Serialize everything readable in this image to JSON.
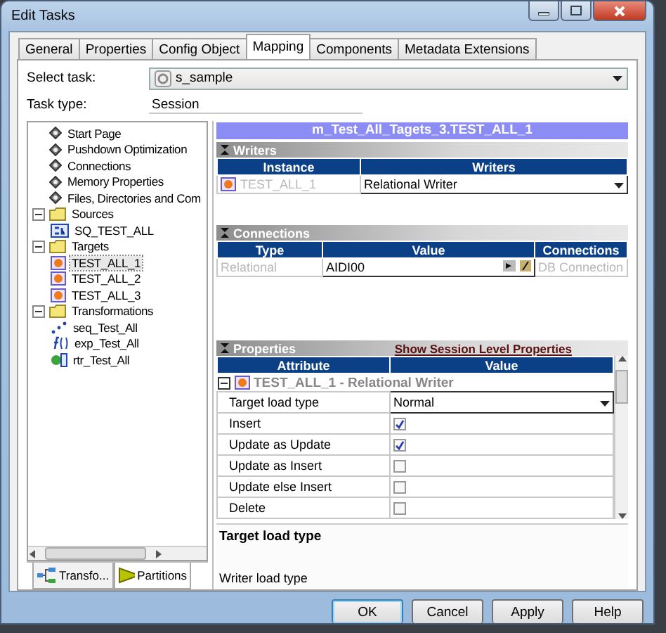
{
  "window": {
    "title": "Edit Tasks"
  },
  "tabs": [
    {
      "label": "General",
      "selected": false
    },
    {
      "label": "Properties",
      "selected": false
    },
    {
      "label": "Config Object",
      "selected": false
    },
    {
      "label": "Mapping",
      "selected": true
    },
    {
      "label": "Components",
      "selected": false
    },
    {
      "label": "Metadata Extensions",
      "selected": false
    }
  ],
  "select_task": {
    "label": "Select task:",
    "value": "s_sample"
  },
  "task_type": {
    "label": "Task type:",
    "value": "Session"
  },
  "tree": [
    {
      "label": "Start Page",
      "kind": "page",
      "selected": false
    },
    {
      "label": "Pushdown Optimization",
      "kind": "page",
      "selected": false
    },
    {
      "label": "Connections",
      "kind": "page",
      "selected": false
    },
    {
      "label": "Memory Properties",
      "kind": "page",
      "selected": false
    },
    {
      "label": "Files, Directories and Com",
      "kind": "page",
      "selected": false
    },
    {
      "label": "Sources",
      "kind": "folder",
      "selected": false,
      "expanded": true,
      "children": [
        {
          "label": "SQ_TEST_ALL",
          "kind": "source",
          "selected": false
        }
      ]
    },
    {
      "label": "Targets",
      "kind": "folder",
      "selected": false,
      "expanded": true,
      "children": [
        {
          "label": "TEST_ALL_1",
          "kind": "target",
          "selected": true
        },
        {
          "label": "TEST_ALL_2",
          "kind": "target",
          "selected": false
        },
        {
          "label": "TEST_ALL_3",
          "kind": "target",
          "selected": false
        }
      ]
    },
    {
      "label": "Transformations",
      "kind": "folder",
      "selected": false,
      "expanded": true,
      "children": [
        {
          "label": "seq_Test_All",
          "kind": "sequence",
          "selected": false
        },
        {
          "label": "exp_Test_All",
          "kind": "expression",
          "selected": false
        },
        {
          "label": "rtr_Test_All",
          "kind": "router",
          "selected": false
        }
      ]
    }
  ],
  "bottom_tabs": [
    {
      "label": "Transfo...",
      "kind": "transformations",
      "selected": false
    },
    {
      "label": "Partitions",
      "kind": "partitions",
      "selected": true
    }
  ],
  "mapping_title": "m_Test_All_Tagets_3.TEST_ALL_1",
  "writers": {
    "title": "Writers",
    "columns": [
      "Instance",
      "Writers"
    ],
    "rows": [
      {
        "instance": "TEST_ALL_1",
        "writer": "Relational Writer"
      }
    ]
  },
  "connections": {
    "title": "Connections",
    "columns": [
      "Type",
      "Value",
      "Connections"
    ],
    "rows": [
      {
        "type": "Relational",
        "value": "AIDI00",
        "connection": "DB Connection"
      }
    ]
  },
  "properties": {
    "title": "Properties",
    "link": "Show Session Level Properties",
    "columns": [
      "Attribute",
      "Value"
    ],
    "group": "TEST_ALL_1 - Relational Writer",
    "expanded": true,
    "rows": [
      {
        "attribute": "Target load type",
        "kind": "dropdown",
        "value": "Normal"
      },
      {
        "attribute": "Insert",
        "kind": "checkbox",
        "checked": true
      },
      {
        "attribute": "Update as Update",
        "kind": "checkbox",
        "checked": true
      },
      {
        "attribute": "Update as Insert",
        "kind": "checkbox",
        "checked": false
      },
      {
        "attribute": "Update else Insert",
        "kind": "checkbox",
        "checked": false
      },
      {
        "attribute": "Delete",
        "kind": "checkbox",
        "checked": false
      }
    ]
  },
  "description": {
    "title": "Target load type",
    "text": "Writer load type"
  },
  "buttons": [
    {
      "label": "OK",
      "default": true
    },
    {
      "label": "Cancel",
      "default": false
    },
    {
      "label": "Apply",
      "default": false
    },
    {
      "label": "Help",
      "default": false
    }
  ]
}
